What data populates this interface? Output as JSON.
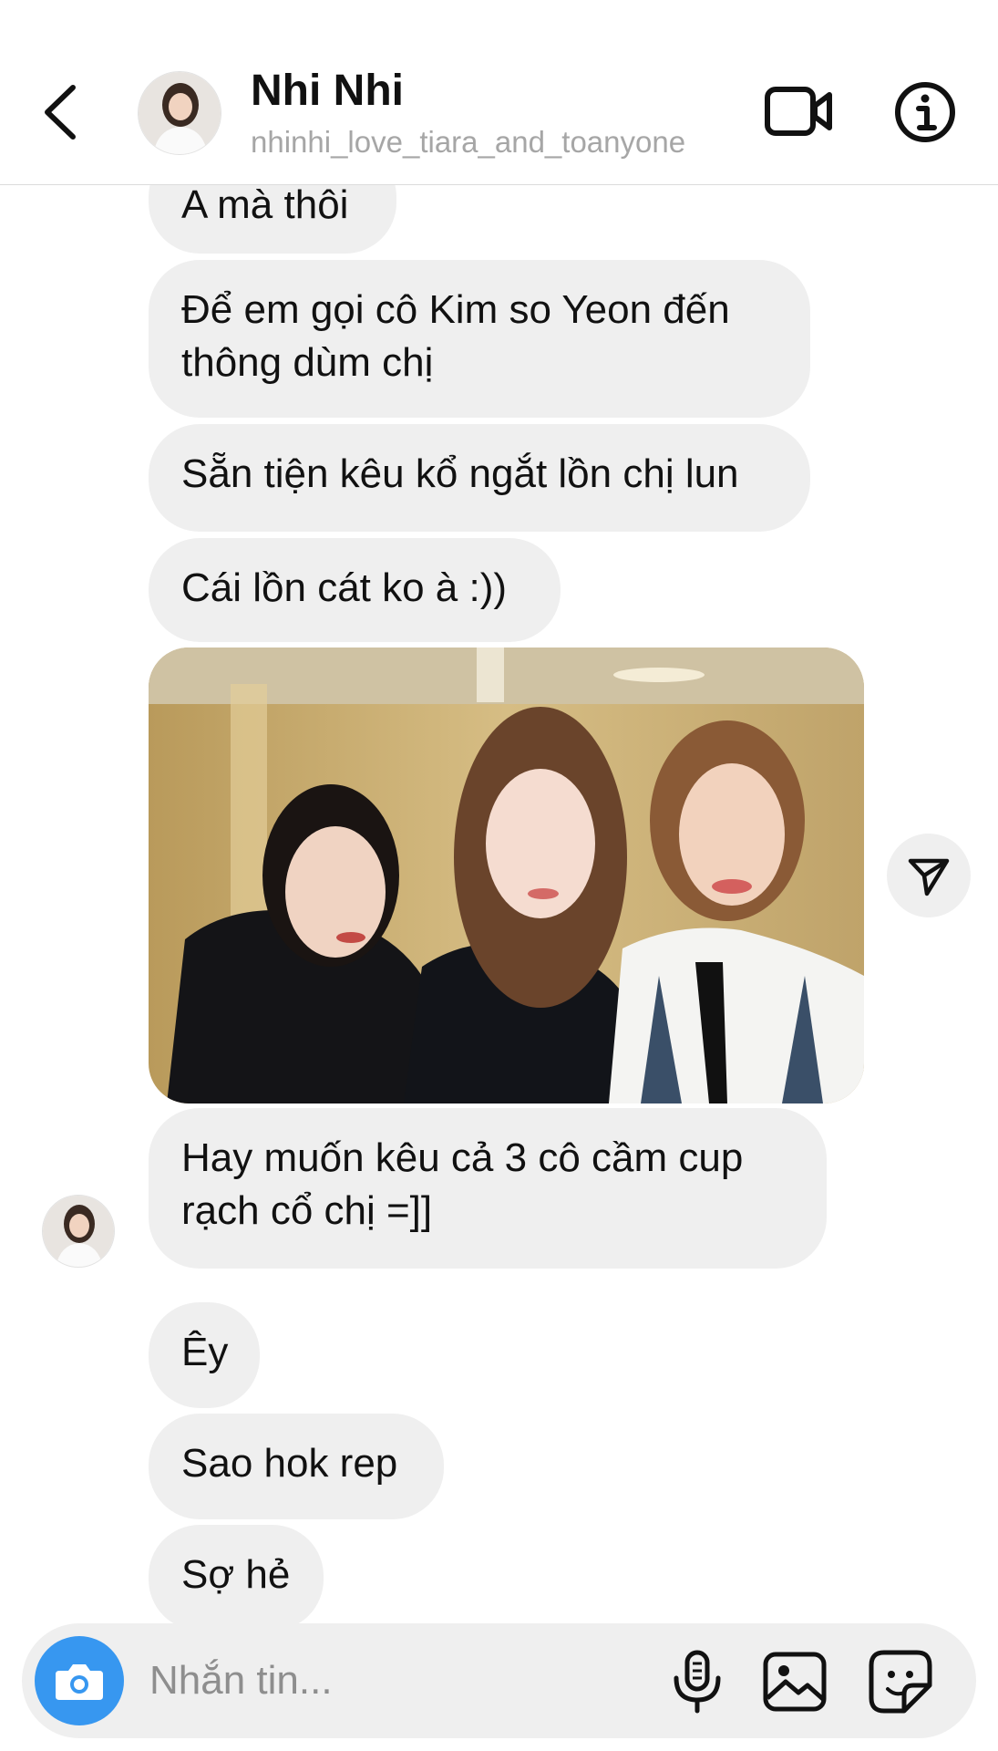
{
  "header": {
    "name": "Nhi Nhi",
    "username": "nhinhi_love_tiara_and_toanyone",
    "icons": [
      "back-chevron-icon",
      "video-call-icon",
      "info-icon"
    ]
  },
  "messages": [
    {
      "text": "A mà thôi"
    },
    {
      "text": "Để em gọi cô Kim so Yeon đến\nthông dùm chị"
    },
    {
      "text": "Sẵn tiện kêu kổ ngắt lồn chị lun"
    },
    {
      "text": "Cái lồn cát ko à :))"
    },
    {
      "text": "Hay muốn kêu cả 3 cô cầm cup\nrạch cổ chị =]]"
    },
    {
      "text": "Êy"
    },
    {
      "text": "Sao hok rep"
    },
    {
      "text": "Sợ hẻ"
    }
  ],
  "composer": {
    "placeholder": "Nhắn tin...",
    "icons": [
      "camera-icon",
      "microphone-icon",
      "gallery-icon",
      "sticker-icon"
    ]
  },
  "colors": {
    "bubble": "#efefef",
    "camera_button": "#3797f0",
    "username": "#a6a6a6"
  }
}
